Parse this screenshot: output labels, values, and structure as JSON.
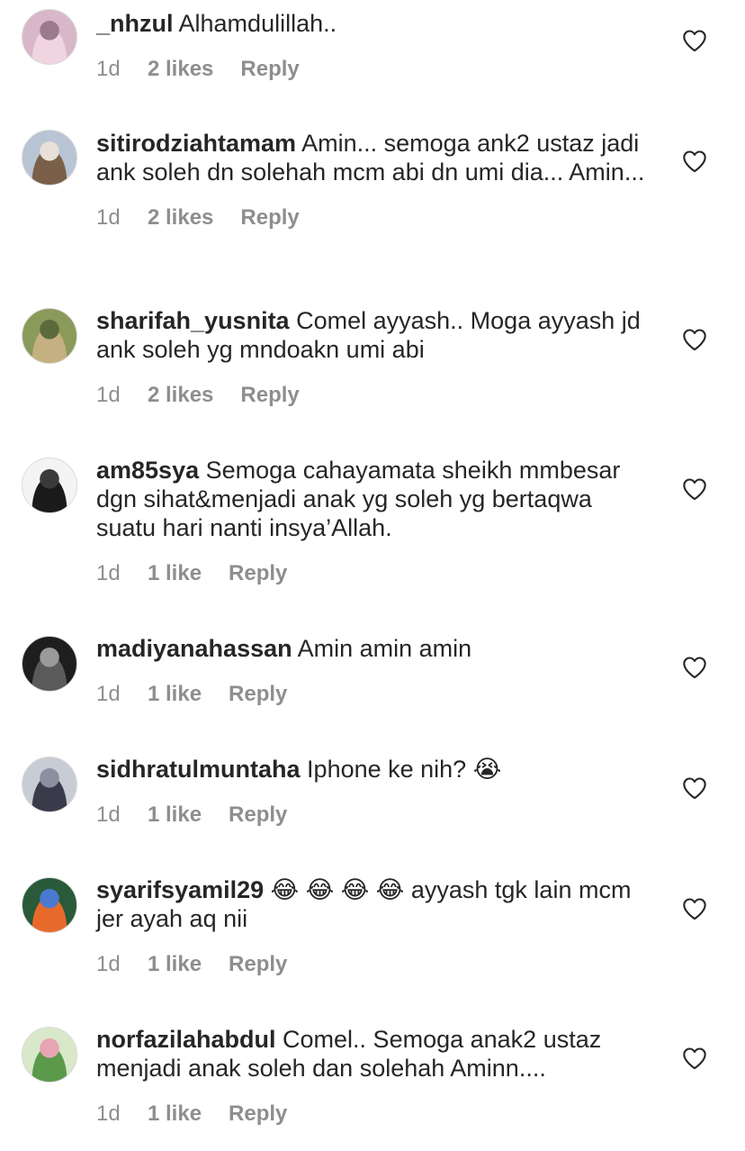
{
  "comments": [
    {
      "username": "_nhzul",
      "text": "Alhamdulillah..",
      "time": "1d",
      "likes": "2 likes",
      "reply": "Reply",
      "avatar_colors": [
        "#d8b8c8",
        "#f0d4e0",
        "#9a7a8c"
      ]
    },
    {
      "username": "sitirodziahtamam",
      "text": "Amin... semoga ank2 ustaz jadi ank soleh dn solehah mcm abi dn umi dia... Amin...",
      "time": "1d",
      "likes": "2 likes",
      "reply": "Reply",
      "avatar_colors": [
        "#b9c4d4",
        "#7a6048",
        "#e8e0d8"
      ]
    },
    {
      "username": "sharifah_yusnita",
      "text": "Comel ayyash.. Moga ayyash jd ank soleh yg mndoakn umi abi",
      "time": "1d",
      "likes": "2 likes",
      "reply": "Reply",
      "avatar_colors": [
        "#8a9a5a",
        "#c4b080",
        "#5a6a3a"
      ]
    },
    {
      "username": "am85sya",
      "text": "Semoga cahayamata sheikh mmbesar dgn sihat&menjadi anak yg soleh yg bertaqwa suatu hari nanti insya’Allah.",
      "time": "1d",
      "likes": "1 like",
      "reply": "Reply",
      "avatar_colors": [
        "#f4f4f4",
        "#1a1a1a",
        "#3a3a3a"
      ]
    },
    {
      "username": "madiyanahassan",
      "text": "Amin amin amin",
      "time": "1d",
      "likes": "1 like",
      "reply": "Reply",
      "avatar_colors": [
        "#1e1e1e",
        "#5a5a5a",
        "#9a9a9a"
      ]
    },
    {
      "username": "sidhratulmuntaha",
      "text": "Iphone ke nih? 😭",
      "time": "1d",
      "likes": "1 like",
      "reply": "Reply",
      "avatar_colors": [
        "#c8ccd4",
        "#3a3a4a",
        "#8a90a0"
      ]
    },
    {
      "username": "syarifsyamil29",
      "text": "😂 😂 😂 😂  ayyash tgk lain mcm jer ayah aq nii",
      "time": "1d",
      "likes": "1 like",
      "reply": "Reply",
      "avatar_colors": [
        "#2a5a3a",
        "#e86a2a",
        "#4a7ad0"
      ]
    },
    {
      "username": "norfazilahabdul",
      "text": "Comel.. Semoga anak2 ustaz menjadi anak soleh dan solehah Aminn....",
      "time": "1d",
      "likes": "1 like",
      "reply": "Reply",
      "avatar_colors": [
        "#d8e8c8",
        "#5a9a4a",
        "#e8a4b4"
      ]
    }
  ]
}
